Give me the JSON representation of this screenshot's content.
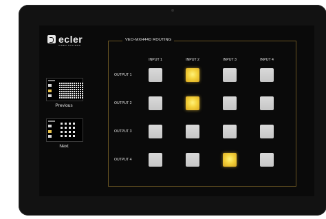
{
  "brand": {
    "name": "ecler",
    "tagline": "VIDEO SYSTEMS"
  },
  "presets": [
    {
      "label": "Previous"
    },
    {
      "label": "Next"
    }
  ],
  "panel": {
    "title": "VEO-MXH44D ROUTING"
  },
  "inputs": [
    "INPUT 1",
    "INPUT 2",
    "INPUT 3",
    "INPUT 4"
  ],
  "outputs": [
    "OUTPUT 1",
    "OUTPUT 2",
    "OUTPUT 3",
    "OUTPUT 4"
  ],
  "routing_selected_input": {
    "OUTPUT 1": "INPUT 2",
    "OUTPUT 2": "INPUT 2",
    "OUTPUT 3": "",
    "OUTPUT 4": "INPUT 3"
  },
  "colors": {
    "active": "#f4d23b",
    "inactive": "#d0d0d0",
    "panel_border": "#6a5522"
  }
}
